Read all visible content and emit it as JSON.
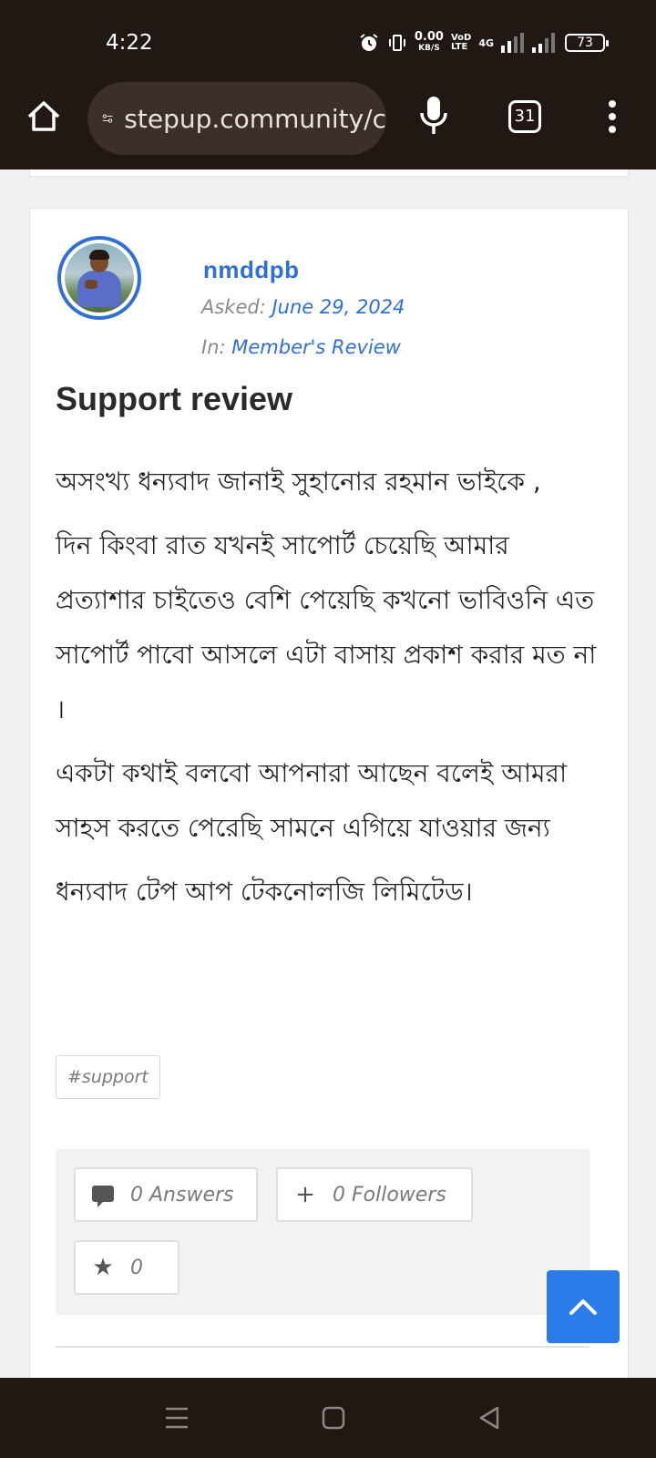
{
  "status_bar": {
    "time": "4:22",
    "net_speed_value": "0.00",
    "net_speed_unit": "KB/S",
    "volte_top": "VoD",
    "volte_bottom": "LTE",
    "network_type": "4G",
    "battery": "73"
  },
  "browser": {
    "url": "stepup.community/c",
    "tab_count": "31"
  },
  "question": {
    "author": "nmddpb",
    "asked_label": "Asked:",
    "asked_date": "June 29, 2024",
    "in_label": "In:",
    "category": "Member's Review",
    "title": "Support review",
    "paragraphs": [
      "অসংখ্য ধন্যবাদ জানাই সুহানোর রহমান ভাইকে ,",
      "দিন কিংবা রাত যখনই সাপোর্ট চেয়েছি আমার প্রত্যাশার চাইতেও বেশি পেয়েছি কখনো ভাবিওনি এত সাপোর্ট পাবো আসলে এটা বাসায় প্রকাশ করার মত না ।",
      "একটা কথাই বলবো আপনারা আছেন বলেই আমরা সাহস করতে পেরেছি সামনে এগিয়ে যাওয়ার জন্য",
      "ধন্যবাদ টেপ আপ টেকনোলজি লিমিটেড।"
    ],
    "tag": "#support",
    "answers_label": "0  Answers",
    "followers_label": "0  Followers",
    "stars_label": "0"
  },
  "icons": {
    "home": "home-icon",
    "site_settings": "tune-icon",
    "mic": "mic-icon",
    "menu": "more-vert-icon",
    "answers": "comment-icon",
    "followers": "plus-icon",
    "star": "star-icon",
    "back_to_top": "chevron-up-icon"
  },
  "colors": {
    "accent": "#2f6fd8",
    "back_to_top": "#2b7ce9",
    "system_bar": "#211713"
  }
}
